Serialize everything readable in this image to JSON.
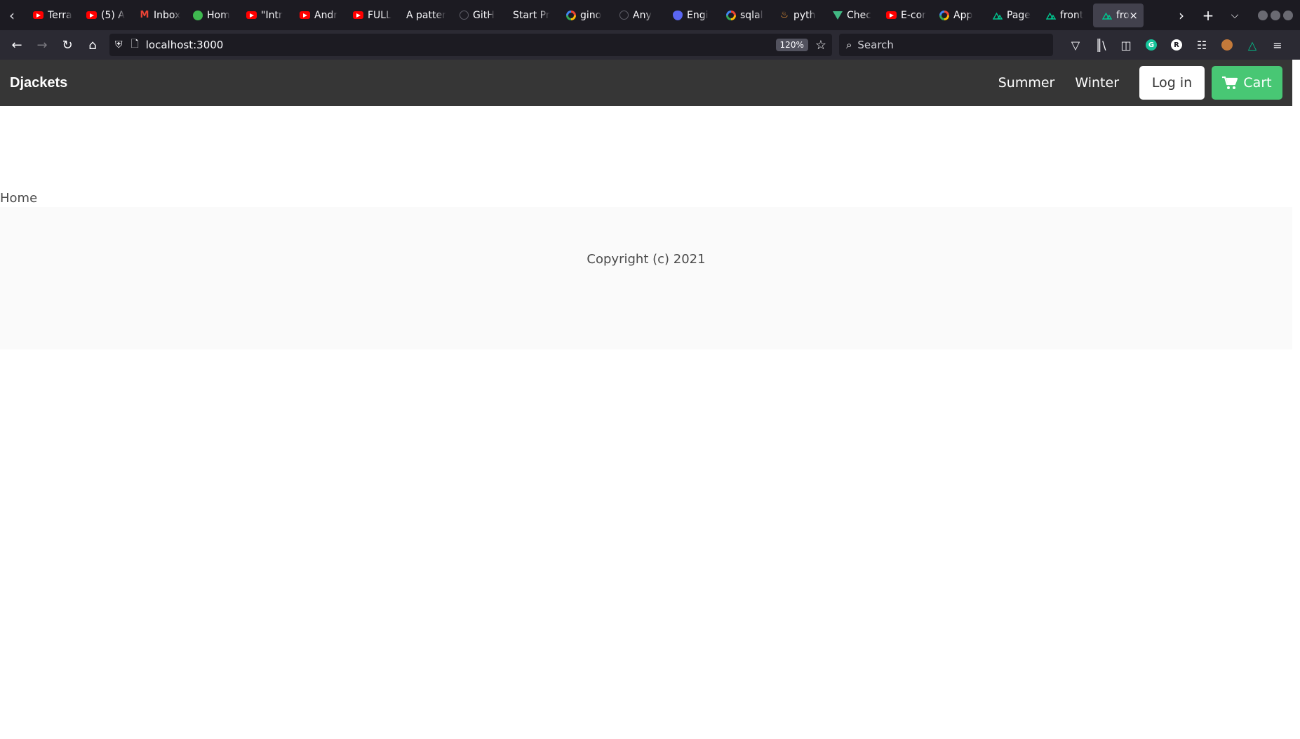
{
  "browser": {
    "tabs": [
      {
        "title": "Terra",
        "favicon": "youtube-icon"
      },
      {
        "title": "(5) A",
        "favicon": "youtube-icon"
      },
      {
        "title": "Inbox",
        "favicon": "gmail-icon"
      },
      {
        "title": "Hom",
        "favicon": "green-dot-icon"
      },
      {
        "title": "\"Intr",
        "favicon": "youtube-icon"
      },
      {
        "title": "Andr",
        "favicon": "youtube-icon"
      },
      {
        "title": "FULL",
        "favicon": "youtube-icon"
      },
      {
        "title": "A patter",
        "favicon": ""
      },
      {
        "title": "GitH",
        "favicon": "github-icon"
      },
      {
        "title": "Start Pr",
        "favicon": ""
      },
      {
        "title": "gino",
        "favicon": "google-icon"
      },
      {
        "title": "Any",
        "favicon": "github-icon"
      },
      {
        "title": "Engi",
        "favicon": "shield-icon"
      },
      {
        "title": "sqlal",
        "favicon": "google-icon"
      },
      {
        "title": "pyth",
        "favicon": "python-icon"
      },
      {
        "title": "Chec",
        "favicon": "vue-icon"
      },
      {
        "title": "E-cor",
        "favicon": "youtube-icon"
      },
      {
        "title": "App",
        "favicon": "google-icon"
      },
      {
        "title": "Page",
        "favicon": "nuxt-icon"
      },
      {
        "title": "front",
        "favicon": "nuxt-icon"
      }
    ],
    "active_tab": {
      "title": "fro",
      "favicon": "nuxt-icon"
    },
    "url": "localhost:3000",
    "zoom": "120%",
    "search_placeholder": "Search",
    "ext_grammarly": "G",
    "ext_r": "R"
  },
  "site": {
    "brand": "Djackets",
    "nav": {
      "summer": "Summer",
      "winter": "Winter",
      "login": "Log in",
      "cart": "Cart"
    },
    "home_label": "Home",
    "footer": {
      "copyright": "Copyright (c) 2021"
    }
  },
  "colors": {
    "navbar_bg": "#363636",
    "cart_green": "#48c774",
    "footer_bg": "#fafafa"
  }
}
